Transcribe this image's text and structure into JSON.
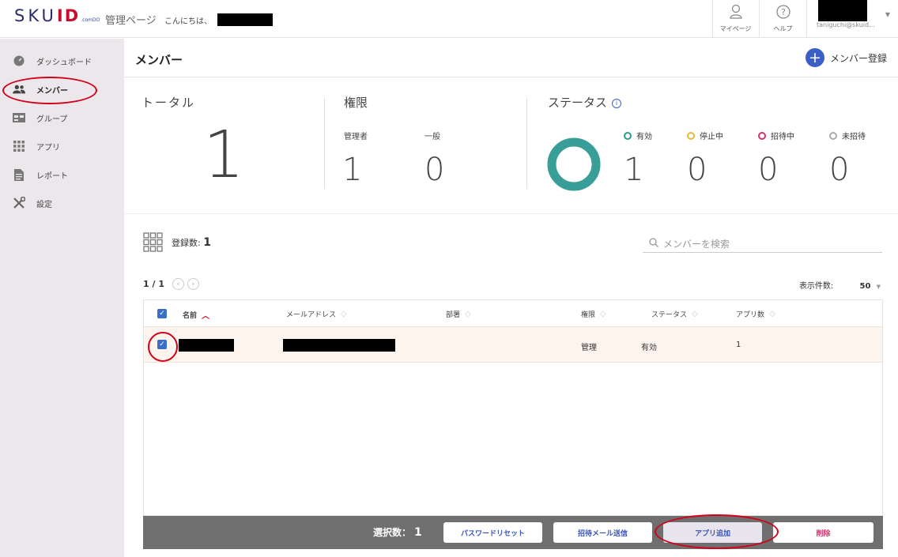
{
  "header": {
    "logo_main": "SKU",
    "logo_id": "ID",
    "logo_sub": ".comDO",
    "admin_label": "管理ページ",
    "greeting": "こんにちは、",
    "mypage_label": "マイページ",
    "help_label": "ヘルプ",
    "user_email_partial": "taniguchi@skuid..."
  },
  "sidebar": {
    "items": [
      {
        "label": "ダッシュボード",
        "icon": "dashboard-icon"
      },
      {
        "label": "メンバー",
        "icon": "members-icon"
      },
      {
        "label": "グループ",
        "icon": "group-icon"
      },
      {
        "label": "アプリ",
        "icon": "apps-grid-icon"
      },
      {
        "label": "レポート",
        "icon": "report-icon"
      },
      {
        "label": "設定",
        "icon": "settings-tools-icon"
      }
    ]
  },
  "main": {
    "title": "メンバー",
    "add_member_label": "メンバー登録",
    "total": {
      "title": "トータル",
      "value": "1"
    },
    "rights": {
      "title": "権限",
      "admin_label": "管理者",
      "admin_value": "1",
      "general_label": "一般",
      "general_value": "0"
    },
    "status": {
      "title": "ステータス",
      "items": [
        {
          "label": "有効",
          "value": "1",
          "color": "#2a9d8f"
        },
        {
          "label": "停止中",
          "value": "0",
          "color": "#e8b931"
        },
        {
          "label": "招待中",
          "value": "0",
          "color": "#d6336c"
        },
        {
          "label": "未招待",
          "value": "0",
          "color": "#aaaaaa"
        }
      ]
    },
    "count_label": "登録数:",
    "count_value": "1",
    "search_placeholder": "メンバーを検索",
    "pager": "1 / 1",
    "per_page_label": "表示件数:",
    "per_page_value": "50",
    "table": {
      "headers": [
        "名前",
        "メールアドレス",
        "部署",
        "権限",
        "ステータス",
        "アプリ数"
      ],
      "rows": [
        {
          "rights": "管理",
          "status": "有効",
          "apps": "1"
        }
      ]
    },
    "actionbar": {
      "selected_label": "選択数：",
      "selected_value": "1",
      "password_reset": "パスワードリセット",
      "send_invite": "招待メール送信",
      "add_app": "アプリ追加",
      "delete": "削除"
    }
  }
}
